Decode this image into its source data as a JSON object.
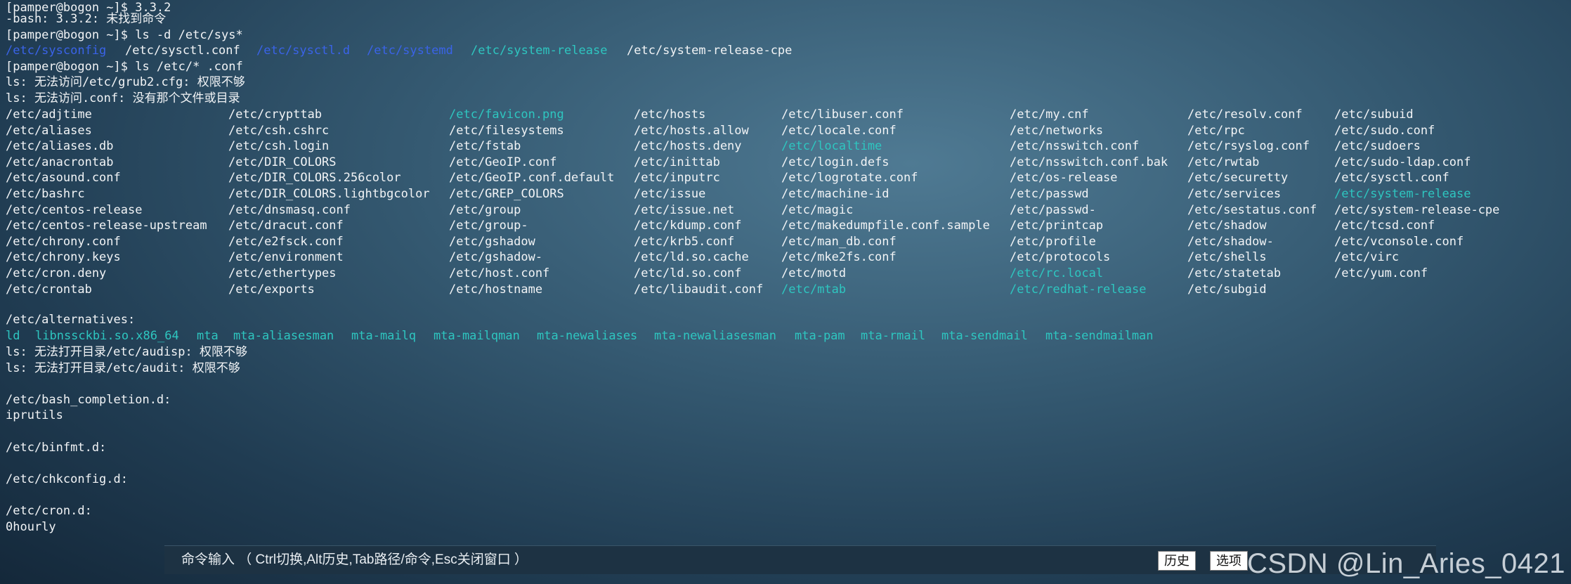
{
  "terminal": {
    "lines": [
      "[pamper@bogon ~]$ 3.3.2",
      "-bash: 3.3.2: 未找到命令",
      "[pamper@bogon ~]$ ls -d /etc/sys*",
      "",
      "[pamper@bogon ~]$ ls /etc/* .conf",
      "ls: 无法访问/etc/grub2.cfg: 权限不够",
      "ls: 无法访问.conf: 没有那个文件或目录"
    ],
    "sys_listing": [
      {
        "text": "/etc/sysconfig",
        "kind": "dir"
      },
      {
        "text": "/etc/sysctl.conf",
        "kind": "plain"
      },
      {
        "text": "/etc/sysctl.d",
        "kind": "dir"
      },
      {
        "text": "/etc/systemd",
        "kind": "dir"
      },
      {
        "text": "/etc/system-release",
        "kind": "link"
      },
      {
        "text": "/etc/system-release-cpe",
        "kind": "plain"
      }
    ],
    "columns": [
      [
        "/etc/adjtime",
        "/etc/aliases",
        "/etc/aliases.db",
        "/etc/anacrontab",
        "/etc/asound.conf",
        "/etc/bashrc",
        "/etc/centos-release",
        "/etc/centos-release-upstream",
        "/etc/chrony.conf",
        "/etc/chrony.keys",
        "/etc/cron.deny",
        "/etc/crontab"
      ],
      [
        "/etc/crypttab",
        "/etc/csh.cshrc",
        "/etc/csh.login",
        "/etc/DIR_COLORS",
        "/etc/DIR_COLORS.256color",
        "/etc/DIR_COLORS.lightbgcolor",
        "/etc/dnsmasq.conf",
        "/etc/dracut.conf",
        "/etc/e2fsck.conf",
        "/etc/environment",
        "/etc/ethertypes",
        "/etc/exports"
      ],
      [
        "/etc/favicon.png",
        "/etc/filesystems",
        "/etc/fstab",
        "/etc/GeoIP.conf",
        "/etc/GeoIP.conf.default",
        "/etc/GREP_COLORS",
        "/etc/group",
        "/etc/group-",
        "/etc/gshadow",
        "/etc/gshadow-",
        "/etc/host.conf",
        "/etc/hostname"
      ],
      [
        "/etc/hosts",
        "/etc/hosts.allow",
        "/etc/hosts.deny",
        "/etc/inittab",
        "/etc/inputrc",
        "/etc/issue",
        "/etc/issue.net",
        "/etc/kdump.conf",
        "/etc/krb5.conf",
        "/etc/ld.so.cache",
        "/etc/ld.so.conf",
        "/etc/libaudit.conf"
      ],
      [
        "/etc/libuser.conf",
        "/etc/locale.conf",
        "/etc/localtime",
        "/etc/login.defs",
        "/etc/logrotate.conf",
        "/etc/machine-id",
        "/etc/magic",
        "/etc/makedumpfile.conf.sample",
        "/etc/man_db.conf",
        "/etc/mke2fs.conf",
        "/etc/motd",
        "/etc/mtab"
      ],
      [
        "/etc/my.cnf",
        "/etc/networks",
        "/etc/nsswitch.conf",
        "/etc/nsswitch.conf.bak",
        "/etc/os-release",
        "/etc/passwd",
        "/etc/passwd-",
        "/etc/printcap",
        "/etc/profile",
        "/etc/protocols",
        "/etc/rc.local",
        "/etc/redhat-release"
      ],
      [
        "/etc/resolv.conf",
        "/etc/rpc",
        "/etc/rsyslog.conf",
        "/etc/rwtab",
        "/etc/securetty",
        "/etc/services",
        "/etc/sestatus.conf",
        "/etc/shadow",
        "/etc/shadow-",
        "/etc/shells",
        "/etc/statetab",
        "/etc/subgid"
      ],
      [
        "/etc/subuid",
        "/etc/sudo.conf",
        "/etc/sudoers",
        "/etc/sudo-ldap.conf",
        "/etc/sysctl.conf",
        "/etc/system-release",
        "/etc/system-release-cpe",
        "/etc/tcsd.conf",
        "/etc/vconsole.conf",
        "/etc/virc",
        "/etc/yum.conf"
      ]
    ],
    "link_entries": [
      "/etc/favicon.png",
      "/etc/localtime",
      "/etc/mtab",
      "/etc/rc.local",
      "/etc/redhat-release",
      "/etc/system-release"
    ],
    "alternatives_header": "/etc/alternatives:",
    "alternatives": [
      "ld",
      "libnssckbi.so.x86_64",
      "mta",
      "mta-aliasesman",
      "mta-mailq",
      "mta-mailqman",
      "mta-newaliases",
      "mta-newaliasesman",
      "mta-pam",
      "mta-rmail",
      "mta-sendmail",
      "mta-sendmailman"
    ],
    "tail_lines": [
      "ls: 无法打开目录/etc/audisp: 权限不够",
      "ls: 无法打开目录/etc/audit: 权限不够",
      "",
      "/etc/bash_completion.d:",
      "iprutils",
      "",
      "/etc/binfmt.d:",
      "",
      "/etc/chkconfig.d:",
      "",
      "/etc/cron.d:",
      "0hourly"
    ]
  },
  "cmdbar": {
    "hint": "命令输入 （ Ctrl切换,Alt历史,Tab路径/命令,Esc关闭窗口 ）",
    "history_label": "历史",
    "options_label": "选项"
  },
  "watermark": "CSDN @Lin_Aries_0421",
  "colors": {
    "directory": "#3a63e8",
    "symlink": "#2ec6c0",
    "text": "#f2f4f6"
  }
}
